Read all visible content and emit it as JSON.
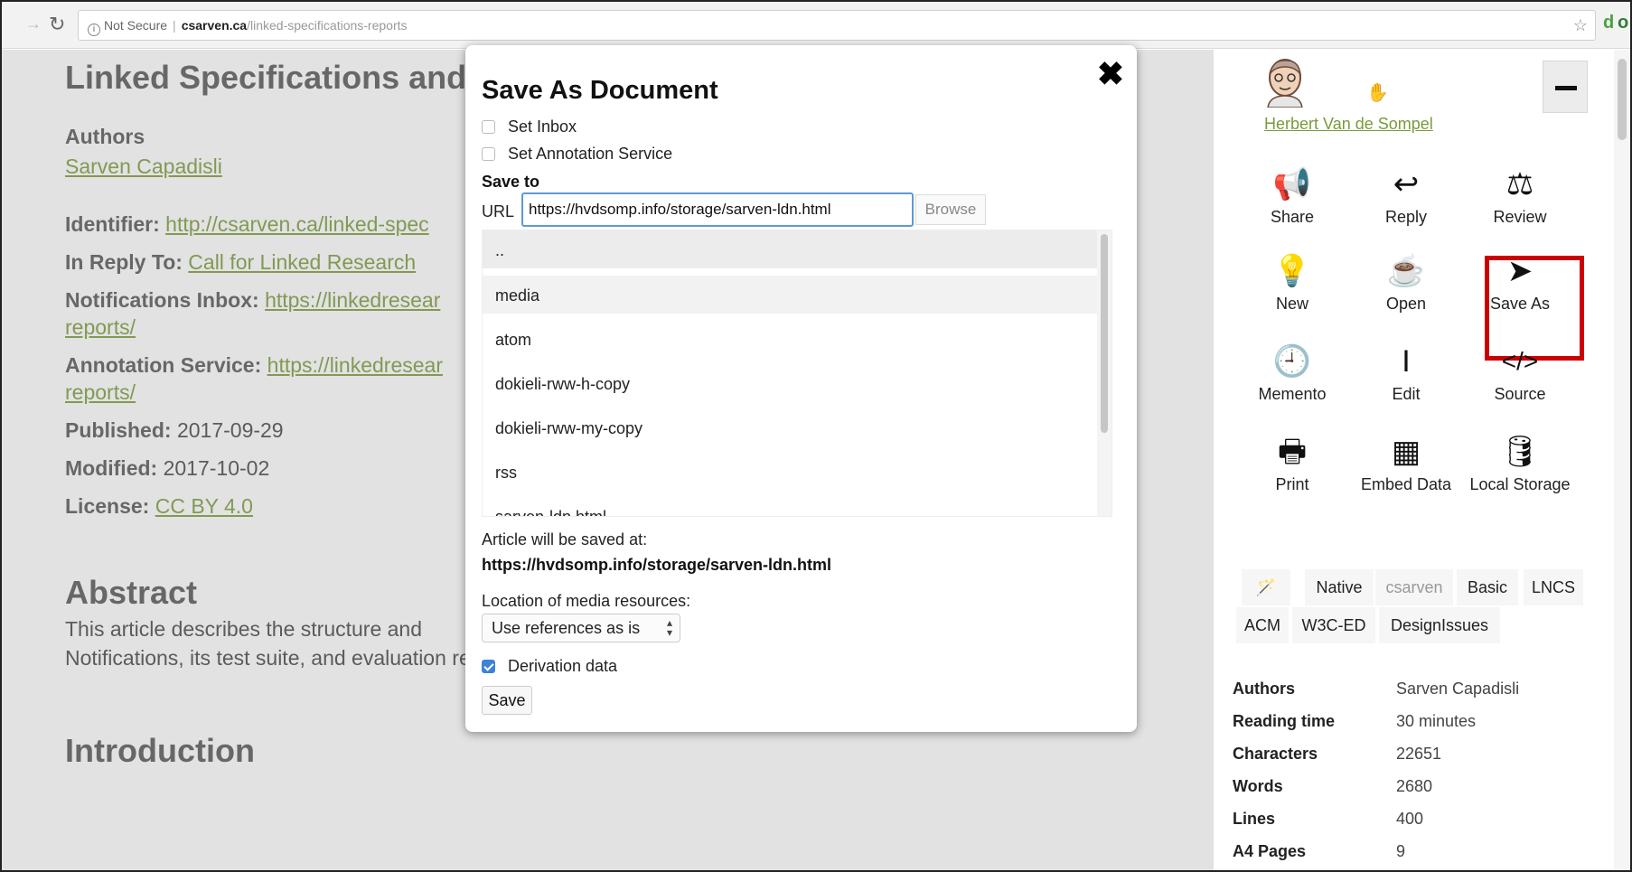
{
  "browser": {
    "security_label": "Not Secure",
    "host": "csarven.ca",
    "path": "/linked-specifications-reports"
  },
  "page": {
    "title": "Linked Specifications and",
    "authors_heading": "Authors",
    "author_name": "Sarven Capadisli",
    "identifier_label": "Identifier:",
    "identifier_value": "http://csarven.ca/linked-spec",
    "in_reply_to_label": "In Reply To:",
    "in_reply_to_value": "Call for Linked Research",
    "notifications_label": "Notifications Inbox:",
    "notifications_value": "https://linkedresear",
    "notifications_value_cont": "reports/",
    "annotation_label": "Annotation Service:",
    "annotation_value": "https://linkedresear",
    "annotation_value_cont": "reports/",
    "published_label": "Published:",
    "published_value": "2017-09-29",
    "modified_label": "Modified:",
    "modified_value": "2017-10-02",
    "license_label": "License:",
    "license_value": "CC BY 4.0",
    "abstract_heading": "Abstract",
    "abstract_line1": "This article describes the structure and",
    "abstract_line2": "Notifications, its test suite, and evaluation reports.",
    "intro_heading": "Introduction"
  },
  "modal": {
    "title": "Save As Document",
    "close_label": "✖",
    "set_inbox": "Set Inbox",
    "set_annotation": "Set Annotation Service",
    "save_to": "Save to",
    "url_label": "URL",
    "url_value": "https://hvdsomp.info/storage/sarven-ldn.html",
    "browse_label": "Browse",
    "folders": [
      "..",
      "media",
      "atom",
      "dokieli-rww-h-copy",
      "dokieli-rww-my-copy",
      "rss",
      "sarven-ldn.html"
    ],
    "saved_at_label": "Article will be saved at:",
    "saved_at_value": "https://hvdsomp.info/storage/sarven-ldn.html",
    "media_label": "Location of media resources:",
    "media_option": "Use references as is",
    "derivation_label": "Derivation data",
    "derivation_checked": true,
    "save_label": "Save"
  },
  "sidebar": {
    "user_name": "Herbert Van de Sompel",
    "tools": [
      {
        "label": "Share",
        "icon": "megaphone-icon"
      },
      {
        "label": "Reply",
        "icon": "reply-icon"
      },
      {
        "label": "Review",
        "icon": "balance-scale-icon"
      },
      {
        "label": "New",
        "icon": "lightbulb-icon"
      },
      {
        "label": "Open",
        "icon": "coffee-cup-icon"
      },
      {
        "label": "Save As",
        "icon": "paper-plane-icon"
      },
      {
        "label": "Memento",
        "icon": "clock-icon"
      },
      {
        "label": "Edit",
        "icon": "text-cursor-icon"
      },
      {
        "label": "Source",
        "icon": "code-icon"
      },
      {
        "label": "Print",
        "icon": "printer-icon"
      },
      {
        "label": "Embed Data",
        "icon": "table-icon"
      },
      {
        "label": "Local Storage",
        "icon": "database-icon"
      }
    ],
    "styles": [
      "Native",
      "csarven",
      "Basic",
      "LNCS",
      "ACM",
      "W3C-ED",
      "DesignIssues"
    ],
    "meta": [
      {
        "key": "Authors",
        "value": "Sarven Capadisli"
      },
      {
        "key": "Reading time",
        "value": "30 minutes"
      },
      {
        "key": "Characters",
        "value": "22651"
      },
      {
        "key": "Words",
        "value": "2680"
      },
      {
        "key": "Lines",
        "value": "400"
      },
      {
        "key": "A4 Pages",
        "value": "9"
      }
    ]
  }
}
